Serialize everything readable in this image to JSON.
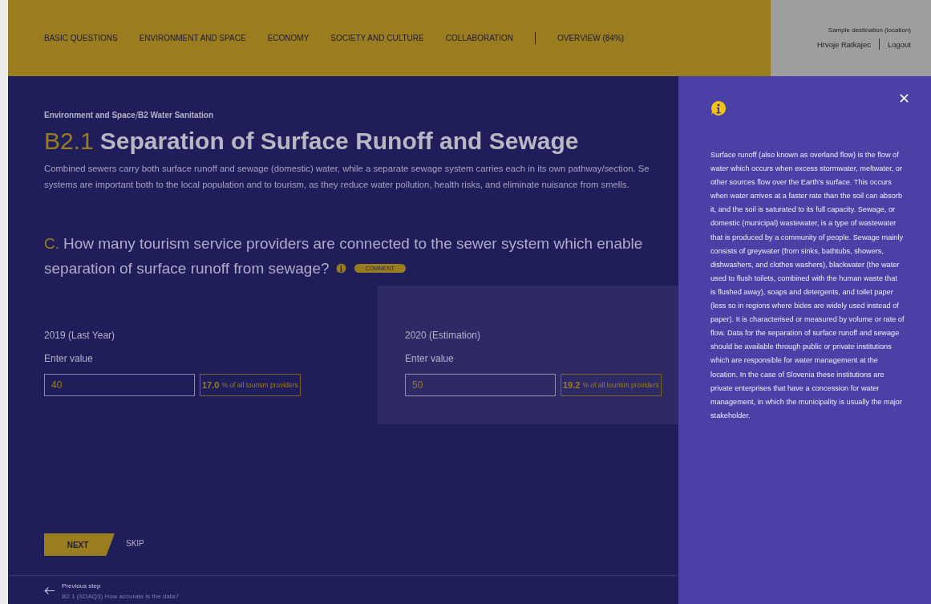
{
  "nav": {
    "items": [
      "BASIC QUESTIONS",
      "ENVIRONMENT AND SPACE",
      "ECONOMY",
      "SOCIETY AND CULTURE",
      "COLLABORATION"
    ],
    "overview": "OVERVIEW (84%)"
  },
  "user": {
    "destination": "Sample destination (location)",
    "name": "Hrvoje Ratkajec",
    "logout": "Logout"
  },
  "breadcrumb": [
    "Environment and Space",
    "B2 Water Sanitation"
  ],
  "title": {
    "code": "B2.1",
    "text": "Separation of Surface Runoff and Sewage"
  },
  "description": "Combined sewers carry both surface runoff and sewage (domestic) water, while a separate sewage system carries each in its own pathway/section. Se\nsystems are important both to the local population and to tourism, as they reduce water pollution, health risks, and eliminate nuisance from smells.",
  "question": {
    "letter": "C.",
    "lines": [
      "How many tourism service providers are connected to the sewer system which enable",
      "separation of surface runoff from sewage?"
    ],
    "comment": "COMMENT"
  },
  "years": [
    {
      "label": "2019 (Last Year)",
      "field_label": "Enter value",
      "value": "40",
      "percent": "17.0",
      "percent_text": "% of all tourism providers",
      "highlighted": false
    },
    {
      "label": "2020 (Estimation)",
      "field_label": "Enter value",
      "value": "50",
      "percent": "19.2",
      "percent_text": "% of all tourism providers",
      "highlighted": true
    }
  ],
  "actions": {
    "next": "NEXT",
    "skip": "SKIP"
  },
  "previous": {
    "label": "Previous step",
    "subtitle": "B2.1 (SDAQ3) How accurate is the data?"
  },
  "info_panel": {
    "text": "Surface runoff (also known as overland flow) is the flow of water which occurs when excess stormwater, meltwater, or other sources flow over the Earth's surface. This occurs when water arrives at a faster rate than the soil can absorb it, and the soil is saturated to its full capacity. Sewage, or domestic (municipal) wastewater, is a type of wastewater that is produced by a community of people. Sewage mainly consists of greywater (from sinks, bathtubs, showers, dishwashers, and clothes washers), blackwater (the water used to flush toilets, combined with the human waste that is flushed away), soaps and detergents, and toilet paper (less so in regions where bides are widely used instead of paper). It is characterised or measured by volume or rate of flow. Data for the separation of surface runoff and sewage should be available through public or private institutions which are responsible for water management at the location. In the case of Slovenia these institutions are private enterprises that have a concession for water management, in which the municipality is usually the major stakeholder."
  }
}
